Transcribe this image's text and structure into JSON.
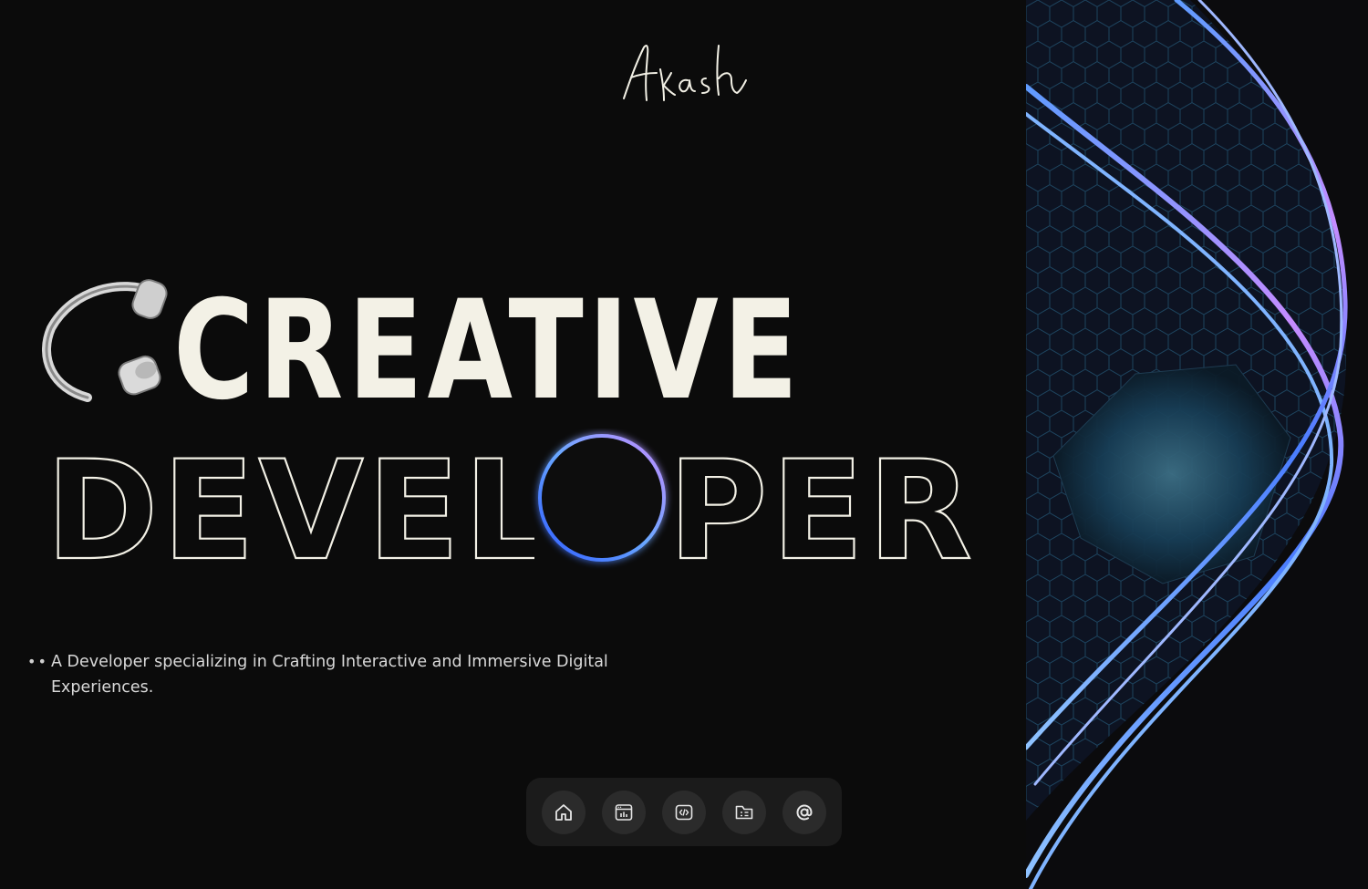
{
  "page": {
    "signature": "Akash",
    "hero": {
      "line1": "CREATIVE",
      "line2": "DEVELOPER"
    },
    "tagline": {
      "bullet": "••",
      "text": "A Developer specializing in Crafting Interactive and Immersive Digital Experiences."
    },
    "dock": {
      "items": [
        {
          "icon": "home-icon"
        },
        {
          "icon": "dashboard-window-icon"
        },
        {
          "icon": "code-icon"
        },
        {
          "icon": "folder-list-icon"
        },
        {
          "icon": "at-sign-icon"
        }
      ]
    },
    "colors": {
      "background": "#0b0b0b",
      "hero_text": "#f3f1e6",
      "ring_gradient": [
        "#3a6cff",
        "#b26bff"
      ],
      "dock_bg": "#1b1b1b",
      "dock_btn": "#2b2b2b",
      "ribbon": [
        "#4a8cff",
        "#c48cff"
      ]
    }
  }
}
